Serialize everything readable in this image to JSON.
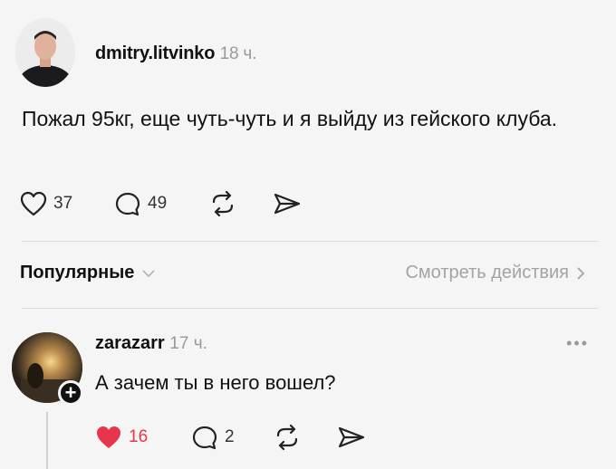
{
  "post": {
    "username": "dmitry.litvinko",
    "time": "18 ч.",
    "text": "Пожал 95кг, еще чуть-чуть и я выйду из гейского клуба.",
    "likes": "37",
    "comments": "49"
  },
  "section": {
    "popular_label": "Популярные",
    "view_activity_label": "Смотреть действия"
  },
  "comment": {
    "username": "zarazarr",
    "time": "17 ч.",
    "text": "А зачем ты в него вошел?",
    "likes": "16",
    "replies": "2",
    "liked": true
  },
  "colors": {
    "like_active": "#e8344c",
    "muted": "#9a9a9a"
  }
}
